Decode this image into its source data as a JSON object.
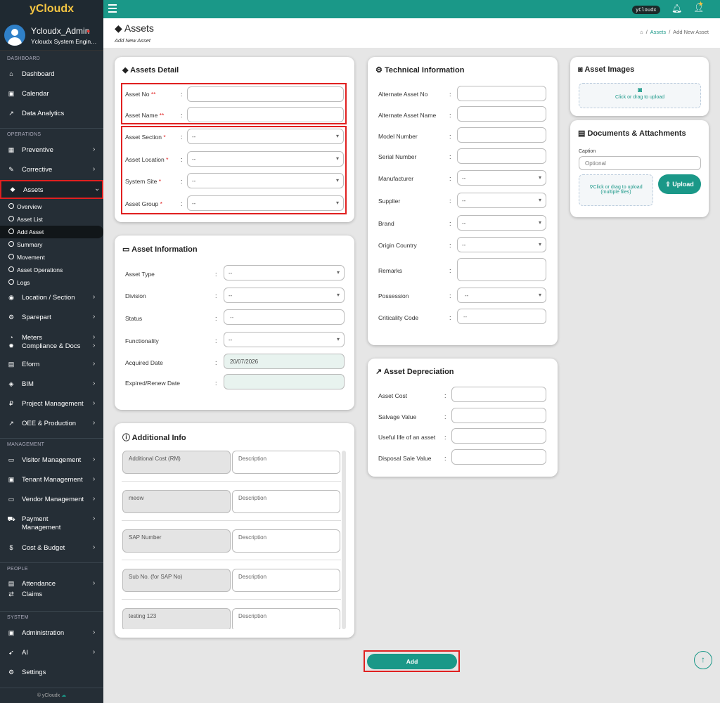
{
  "app": {
    "logo": "yCloudx",
    "badge": "yCloudx"
  },
  "profile": {
    "name": "Ycloudx_Admin",
    "role": "Ycloudx System Engin…"
  },
  "sidebar": {
    "sections": {
      "dashboard": "DASHBOARD",
      "operations": "OPERATIONS",
      "management": "MANAGEMENT",
      "people": "PEOPLE",
      "system": "SYSTEM"
    },
    "items": {
      "dashboard": "Dashboard",
      "calendar": "Calendar",
      "analytics": "Data Analytics",
      "preventive": "Preventive",
      "corrective": "Corrective",
      "assets": "Assets",
      "location": "Location / Section",
      "sparepart": "Sparepart",
      "meters": "Meters",
      "compliance": "Compliance & Docs",
      "eform": "Eform",
      "bim": "BIM",
      "project": "Project Management",
      "oee": "OEE & Production",
      "visitor": "Visitor Management",
      "tenant": "Tenant Management",
      "vendor": "Vendor Management",
      "payment": "Payment",
      "payment2": "Management",
      "cost": "Cost & Budget",
      "attendance": "Attendance",
      "claims": "Claims",
      "administration": "Administration",
      "ai": "AI",
      "settings": "Settings"
    },
    "subitems": {
      "overview": "Overview",
      "assetlist": "Asset List",
      "addasset": "Add Asset",
      "summary": "Summary",
      "movement": "Movement",
      "operations": "Asset Operations",
      "logs": "Logs"
    },
    "footer": "© yCloudx"
  },
  "header": {
    "title": "Assets",
    "subtitle": "Add New Asset",
    "crumb_link": "Assets",
    "crumb_current": "Add New Asset"
  },
  "assets_detail": {
    "title": "Assets Detail",
    "asset_no": "Asset No",
    "asset_name": "Asset Name",
    "section": "Asset Section",
    "location": "Asset Location",
    "site": "System Site",
    "group": "Asset Group",
    "dd": "--"
  },
  "asset_info": {
    "title": "Asset Information",
    "type": "Asset Type",
    "division": "Division",
    "status": "Status",
    "functionality": "Functionality",
    "acquired": "Acquired Date",
    "acquired_value": "20/07/2026",
    "expired": "Expired/Renew Date",
    "dd": "--"
  },
  "additional": {
    "title": "Additional Info",
    "rows": [
      "Additional Cost (RM)",
      "meow",
      "SAP Number",
      "Sub No. (for SAP No)",
      "testing 123"
    ],
    "desc": "Description"
  },
  "tech": {
    "title": "Technical Information",
    "alt_no": "Alternate Asset No",
    "alt_name": "Alternate Asset Name",
    "model": "Model Number",
    "serial": "Serial Number",
    "manufacturer": "Manufacturer",
    "supplier": "Supplier",
    "brand": "Brand",
    "origin": "Origin Country",
    "remarks": "Remarks",
    "possession": "Possession",
    "criticality": "Criticality Code",
    "dd": "--"
  },
  "depreciation": {
    "title": "Asset Depreciation",
    "cost": "Asset Cost",
    "salvage": "Salvage Value",
    "life": "Useful life of an asset",
    "disposal": "Disposal Sale Value"
  },
  "images": {
    "title": "Asset Images",
    "upload": "Click or drag to upload"
  },
  "docs": {
    "title": "Documents & Attachments",
    "caption_label": "Caption",
    "caption_placeholder": "Optional",
    "upload1": "Click or drag to upload",
    "upload2": "(multiple files)",
    "upload_btn": "Upload"
  },
  "actions": {
    "add": "Add"
  },
  "colors": {
    "accent": "#1a9888",
    "sidebar": "#252e36",
    "highlight": "#e02020"
  }
}
